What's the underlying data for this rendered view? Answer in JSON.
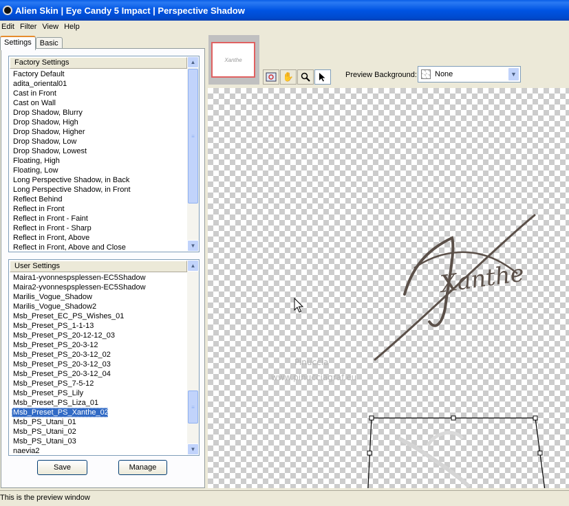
{
  "window": {
    "title": "Alien Skin | Eye Candy 5 Impact | Perspective Shadow"
  },
  "menu": [
    "Edit",
    "Filter",
    "View",
    "Help"
  ],
  "tabs": [
    "Settings",
    "Basic"
  ],
  "factory_settings": {
    "header": "Factory Settings",
    "items": [
      "Factory Default",
      "adita_oriental01",
      "Cast in Front",
      "Cast on Wall",
      "Drop Shadow, Blurry",
      "Drop Shadow, High",
      "Drop Shadow, Higher",
      "Drop Shadow, Low",
      "Drop Shadow, Lowest",
      "Floating, High",
      "Floating, Low",
      "Long Perspective Shadow, in Back",
      "Long Perspective Shadow, in Front",
      "Reflect Behind",
      "Reflect in Front",
      "Reflect in Front - Faint",
      "Reflect in Front - Sharp",
      "Reflect in Front, Above",
      "Reflect in Front, Above and Close"
    ]
  },
  "user_settings": {
    "header": "User Settings",
    "items": [
      "Maira1-yvonnespsplessen-EC5Shadow",
      "Maira2-yvonnespsplessen-EC5Shadow",
      "Marilis_Vogue_Shadow",
      "Marilis_Vogue_Shadow2",
      "Msb_Preset_EC_PS_Wishes_01",
      "Msb_Preset_PS_1-1-13",
      "Msb_Preset_PS_20-12-12_03",
      "Msb_Preset_PS_20-3-12",
      "Msb_Preset_PS_20-3-12_02",
      "Msb_Preset_PS_20-3-12_03",
      "Msb_Preset_PS_20-3-12_04",
      "Msb_Preset_PS_7-5-12",
      "Msb_Preset_PS_Lily",
      "Msb_Preset_PS_Liza_01",
      "Msb_Preset_PS_Xanthe_02",
      "Msb_PS_Utani_01",
      "Msb_PS_Utani_02",
      "Msb_PS_Utani_03",
      "naevia2"
    ],
    "selected": "Msb_Preset_PS_Xanthe_02"
  },
  "buttons": {
    "save": "Save",
    "manage": "Manage"
  },
  "preview": {
    "background_label": "Preview Background:",
    "background_value": "None",
    "watermark_line1": "Pinuccia",
    "watermark_line2": "www.pinucciagraf.eu",
    "artwork_text": "Xanthe"
  },
  "tools": [
    "navigator-icon",
    "hand-icon",
    "zoom-icon",
    "pointer-icon"
  ],
  "status": "This is the preview window",
  "colors": {
    "titlebar": "#0054e3",
    "selection": "#316ac5",
    "artwork": "#5b5049"
  }
}
